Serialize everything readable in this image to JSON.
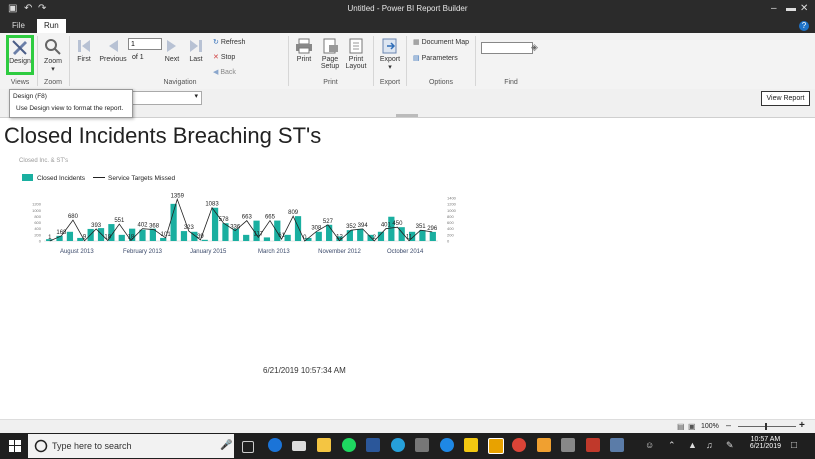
{
  "window": {
    "title": "Untitled - Power BI Report Builder",
    "controls": [
      "minimize",
      "restore",
      "close"
    ]
  },
  "tabs": [
    {
      "label": "File"
    },
    {
      "label": "Run"
    }
  ],
  "ribbon": {
    "views": {
      "design_label": "Design",
      "group_label": "Views"
    },
    "zoom": {
      "zoom_label": "Zoom",
      "group_label": "Zoom"
    },
    "navigation": {
      "first_label": "First",
      "previous_label": "Previous",
      "page_value": "1",
      "of_label": "of 1",
      "next_label": "Next",
      "last_label": "Last",
      "refresh_label": "Refresh",
      "stop_label": "Stop",
      "back_label": "Back",
      "group_label": "Navigation"
    },
    "print": {
      "print_label": "Print",
      "page_setup_label": "Page Setup",
      "print_layout_label": "Print Layout",
      "group_label": "Print"
    },
    "export": {
      "export_label": "Export",
      "group_label": "Export"
    },
    "options": {
      "document_map_label": "Document Map",
      "parameters_label": "Parameters",
      "group_label": "Options"
    },
    "find": {
      "group_label": "Find",
      "search_value": ""
    }
  },
  "toolbar": {
    "combo_value": "g",
    "view_report_label": "View Report"
  },
  "tooltip": {
    "title": "Design (F8)",
    "body": "Use Design view to format the report."
  },
  "report": {
    "title": "Closed Incidents Breaching ST's",
    "chart_subtitle": "Closed Inc. & ST's",
    "timestamp": "6/21/2019 10:57:34 AM"
  },
  "chart_data": {
    "type": "bar",
    "title": "Closed Inc. & ST's",
    "series": [
      {
        "name": "Closed Incidents",
        "type": "bar",
        "color": "#1aafa0",
        "values": [
          60,
          168,
          300,
          100,
          393,
          420,
          551,
          200,
          402,
          368,
          400,
          101,
          1209,
          323,
          300,
          39,
          1083,
          578,
          400,
          200,
          663,
          117,
          665,
          200,
          809,
          100,
          300,
          527,
          150,
          352,
          394,
          200,
          300,
          790,
          450,
          300,
          351,
          296
        ]
      },
      {
        "name": "Service Targets Missed",
        "type": "line",
        "color": "#222222",
        "values": [
          1,
          168,
          680,
          9,
          393,
          18,
          551,
          18,
          402,
          368,
          101,
          1359,
          323,
          39,
          1083,
          578,
          336,
          663,
          117,
          665,
          61,
          809,
          0,
          308,
          527,
          12,
          352,
          394,
          2,
          401,
          450,
          11,
          351,
          296
        ]
      }
    ],
    "data_labels": [
      "1",
      "168",
      "680",
      "9",
      "393",
      "18",
      "551",
      "18",
      "402",
      "368",
      "101",
      "1359",
      "323",
      "39",
      "1083",
      "578",
      "336",
      "663",
      "117",
      "665",
      "61",
      "809",
      "0",
      "308",
      "527",
      "12",
      "352",
      "394",
      "2",
      "401",
      "450",
      "11",
      "351",
      "296"
    ],
    "x_tick_labels": [
      "August 2013",
      "February 2013",
      "January 2015",
      "March 2013",
      "November 2012",
      "October 2014"
    ],
    "y_left_ticks": [
      "0",
      "200",
      "400",
      "600",
      "800",
      "1000",
      "1200"
    ],
    "y_right_ticks": [
      "0",
      "200",
      "400",
      "600",
      "800",
      "1000",
      "1200",
      "1400"
    ],
    "ylim": [
      0,
      1400
    ],
    "legend_position": "top-left"
  },
  "statusbar": {
    "zoom_value": "100%"
  },
  "taskbar": {
    "search_placeholder": "Type here to search",
    "time": "10:57 AM",
    "date": "6/21/2019"
  }
}
